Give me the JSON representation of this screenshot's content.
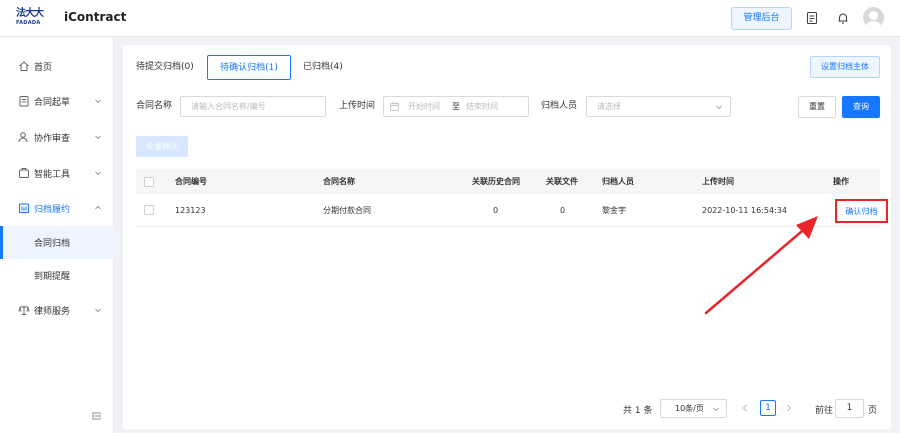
{
  "header": {
    "logo_cn": "法大大",
    "logo_en": "FADADA",
    "app_name": "iContract",
    "admin_button": "管理后台",
    "icons": [
      "document-icon",
      "bell-icon",
      "avatar"
    ]
  },
  "sidebar": {
    "items": [
      {
        "label": "首页",
        "icon": "home-icon"
      },
      {
        "label": "合同起草",
        "icon": "draft-icon",
        "chevron": "down"
      },
      {
        "label": "协作审查",
        "icon": "user-review-icon",
        "chevron": "down"
      },
      {
        "label": "智能工具",
        "icon": "tools-icon",
        "chevron": "down"
      },
      {
        "label": "归档履约",
        "icon": "archive-icon",
        "chevron": "up"
      },
      {
        "label": "律师服务",
        "icon": "scale-icon",
        "chevron": "down"
      }
    ],
    "sub_items": [
      {
        "label": "合同归档"
      },
      {
        "label": "到期提醒"
      }
    ]
  },
  "tabs": [
    {
      "label": "待提交归档(0)"
    },
    {
      "label": "待确认归档(1)"
    },
    {
      "label": "已归档(4)"
    }
  ],
  "set_subject_button": "设置归档主体",
  "filters": {
    "contract_name_label": "合同名称",
    "contract_name_placeholder": "请输入合同名称/编号",
    "upload_time_label": "上传时间",
    "start_placeholder": "开始时间",
    "range_sep": "至",
    "end_placeholder": "结束时间",
    "archiver_label": "归档人员",
    "archiver_placeholder": "请选择",
    "reset_button": "重置",
    "query_button": "查询"
  },
  "batch_confirm_button": "批量确认",
  "table": {
    "columns": [
      "合同编号",
      "合同名称",
      "关联历史合同",
      "关联文件",
      "归档人员",
      "上传时间",
      "操作"
    ],
    "rows": [
      {
        "contract_no": "123123",
        "contract_name": "分期付款合同",
        "related_history": "0",
        "related_files": "0",
        "archiver": "黎金宇",
        "upload_time": "2022-10-11 16:54:34",
        "action": "确认归档"
      }
    ]
  },
  "pagination": {
    "total": "共 1 条",
    "page_size": "10条/页",
    "current_page": "1",
    "goto_label": "前往",
    "goto_value": "1",
    "page_suffix": "页"
  },
  "colors": {
    "primary": "#1677ff",
    "annotation_red": "#e8262a",
    "brand_navy": "#1a3a8f"
  }
}
